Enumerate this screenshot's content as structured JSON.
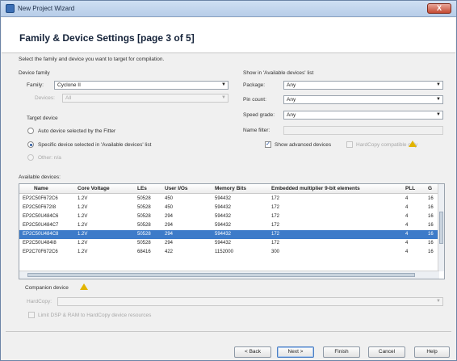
{
  "window": {
    "title": "New Project Wizard",
    "close_glyph": "X"
  },
  "header": {
    "title": "Family & Device Settings [page 3 of 5]"
  },
  "subtitle": "Select the family and device you want to target for compilation.",
  "device_family": {
    "heading": "Device family",
    "family_label": "Family:",
    "family_value": "Cyclone II",
    "devices_label": "Devices:",
    "devices_value": "All"
  },
  "target_device": {
    "heading": "Target device",
    "auto_label": "Auto device selected by the Fitter",
    "specific_label": "Specific device selected in 'Available devices' list",
    "other_label": "Other: n/a"
  },
  "filters": {
    "heading": "Show in 'Available devices' list",
    "package_label": "Package:",
    "package_value": "Any",
    "pin_count_label": "Pin count:",
    "pin_count_value": "Any",
    "speed_grade_label": "Speed grade:",
    "speed_grade_value": "Any",
    "name_filter_label": "Name filter:",
    "show_advanced_label": "Show advanced devices",
    "hardcopy_compatible_label": "HardCopy compatible only"
  },
  "available_devices": {
    "label": "Available devices:",
    "columns": [
      "Name",
      "Core Voltage",
      "LEs",
      "User I/Os",
      "Memory Bits",
      "Embedded multiplier 9-bit elements",
      "PLL",
      "G"
    ],
    "rows": [
      [
        "EP2C50F672C6",
        "1.2V",
        "50528",
        "450",
        "594432",
        "172",
        "4",
        "16"
      ],
      [
        "EP2C50F672I8",
        "1.2V",
        "50528",
        "450",
        "594432",
        "172",
        "4",
        "16"
      ],
      [
        "EP2C50U484C6",
        "1.2V",
        "50528",
        "294",
        "594432",
        "172",
        "4",
        "16"
      ],
      [
        "EP2C50U484C7",
        "1.2V",
        "50528",
        "294",
        "594432",
        "172",
        "4",
        "16"
      ],
      [
        "EP2C50U484C8",
        "1.2V",
        "50528",
        "294",
        "594432",
        "172",
        "4",
        "16"
      ],
      [
        "EP2C50U484I8",
        "1.2V",
        "50528",
        "294",
        "594432",
        "172",
        "4",
        "16"
      ],
      [
        "EP2C70F672C6",
        "1.2V",
        "68416",
        "422",
        "1152000",
        "300",
        "4",
        "16"
      ]
    ],
    "selected_row": 4
  },
  "companion": {
    "label": "Companion device",
    "hardcopy_label": "HardCopy:",
    "limit_label": "Limit DSP & RAM to HardCopy device resources"
  },
  "buttons": {
    "back": "< Back",
    "next": "Next >",
    "finish": "Finish",
    "cancel": "Cancel",
    "help": "Help"
  },
  "colors": {
    "selection": "#3d7bc9",
    "warning": "#e2b400"
  }
}
